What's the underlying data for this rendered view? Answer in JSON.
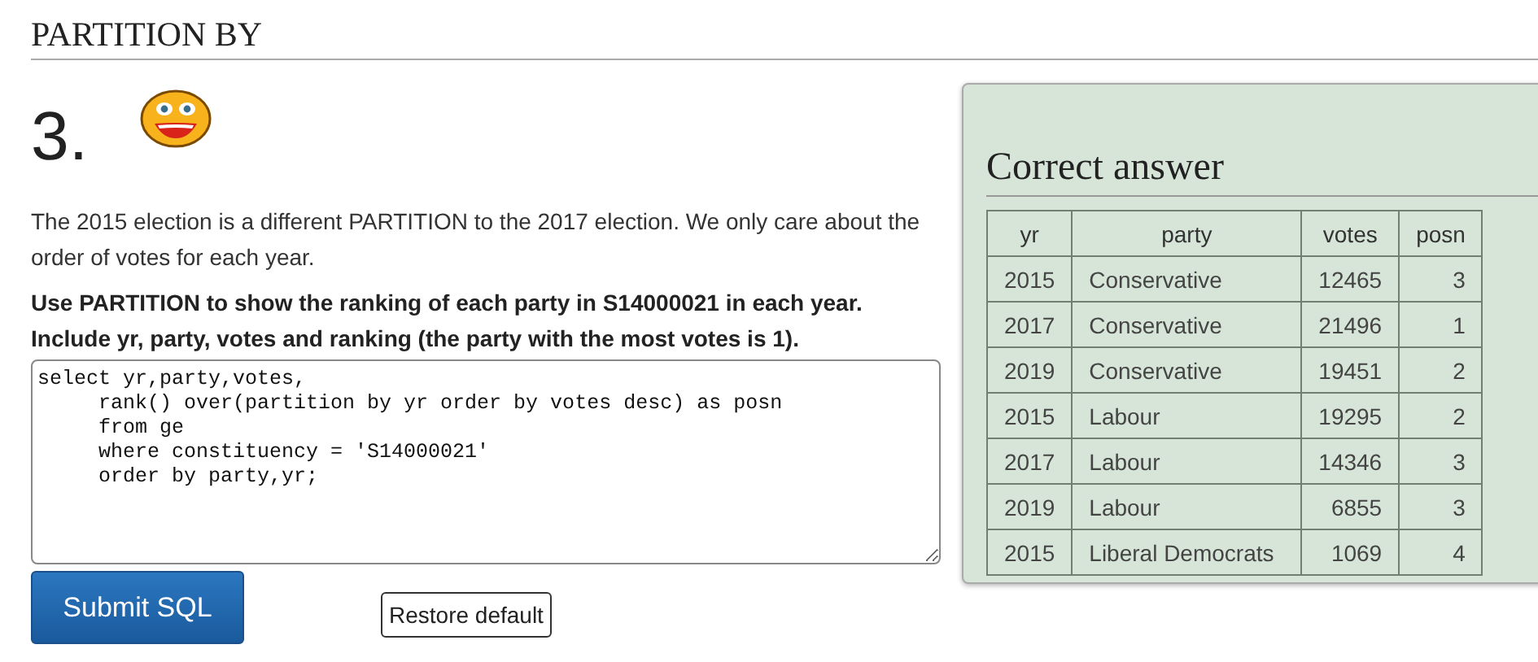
{
  "page_title": "PARTITION BY",
  "question": {
    "number": "3.",
    "intro": "The 2015 election is a different PARTITION to the 2017 election. We only care about the order of votes for each year.",
    "task": "Use PARTITION to show the ranking of each party in S14000021 in each year. Include yr, party, votes and ranking (the party with the most votes is 1).",
    "sql": "select yr,party,votes,\n     rank() over(partition by yr order by votes desc) as posn\n     from ge\n     where constituency = 'S14000021'\n     order by party,yr;"
  },
  "buttons": {
    "submit": "Submit SQL",
    "restore": "Restore default"
  },
  "answer": {
    "title": "Correct answer",
    "columns": [
      "yr",
      "party",
      "votes",
      "posn"
    ],
    "rows": [
      [
        "2015",
        "Conservative",
        "12465",
        "3"
      ],
      [
        "2017",
        "Conservative",
        "21496",
        "1"
      ],
      [
        "2019",
        "Conservative",
        "19451",
        "2"
      ],
      [
        "2015",
        "Labour",
        "19295",
        "2"
      ],
      [
        "2017",
        "Labour",
        "14346",
        "3"
      ],
      [
        "2019",
        "Labour",
        "6855",
        "3"
      ],
      [
        "2015",
        "Liberal Democrats",
        "1069",
        "4"
      ]
    ]
  }
}
